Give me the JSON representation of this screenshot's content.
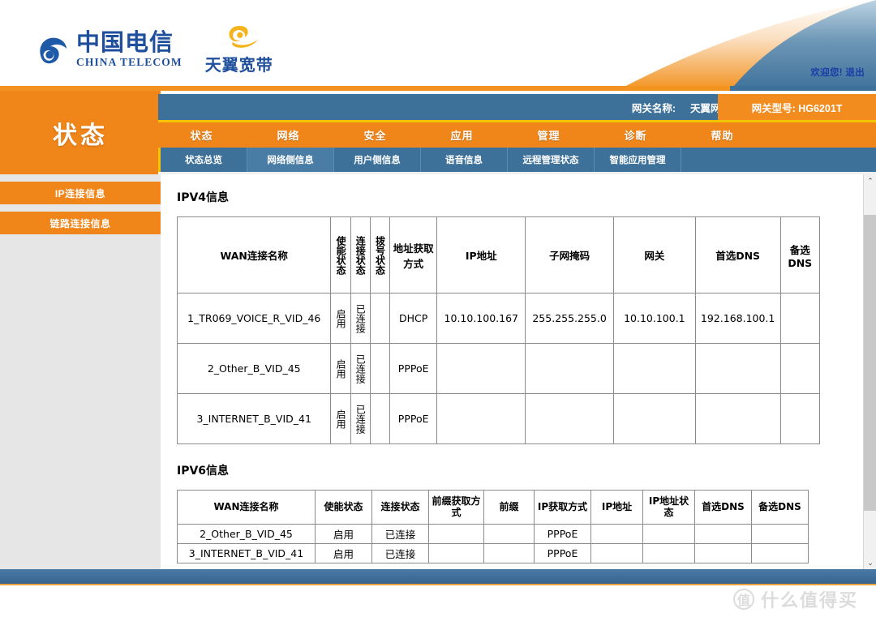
{
  "header": {
    "brand_cn": "中国电信",
    "brand_en": "CHINA TELECOM",
    "sub_brand": "天翼宽带",
    "welcome": "欢迎您!",
    "logout": "退出"
  },
  "gateway": {
    "name_label": "网关名称:",
    "name_value": "天翼网关-GPON",
    "model_label": "网关型号:",
    "model_value": "HG6201T",
    "model_text": "网关型号: HG6201T"
  },
  "sidebar": {
    "title": "状态",
    "items": [
      {
        "label": "IP连接信息"
      },
      {
        "label": "链路连接信息"
      }
    ]
  },
  "nav": {
    "items": [
      {
        "label": "状态"
      },
      {
        "label": "网络"
      },
      {
        "label": "安全"
      },
      {
        "label": "应用"
      },
      {
        "label": "管理"
      },
      {
        "label": "诊断"
      },
      {
        "label": "帮助"
      }
    ]
  },
  "subnav": {
    "items": [
      {
        "label": "状态总览",
        "active": false
      },
      {
        "label": "网络侧信息",
        "active": true
      },
      {
        "label": "用户侧信息",
        "active": false
      },
      {
        "label": "语音信息",
        "active": false
      },
      {
        "label": "远程管理状态",
        "active": false
      },
      {
        "label": "智能应用管理",
        "active": false
      }
    ]
  },
  "ipv4": {
    "title": "IPV4信息",
    "headers": [
      "WAN连接名称",
      "使能状态",
      "连接状态",
      "拨号状态",
      "地址获取方式",
      "IP地址",
      "子网掩码",
      "网关",
      "首选DNS",
      "备选DNS"
    ],
    "rows": [
      {
        "name": "1_TR069_VOICE_R_VID_46",
        "enable": "启用",
        "conn": "已连接",
        "dial": "",
        "mode": "DHCP",
        "ip": "10.10.100.167",
        "mask": "255.255.255.0",
        "gateway": "10.10.100.1",
        "dns1": "192.168.100.1",
        "dns2": ""
      },
      {
        "name": "2_Other_B_VID_45",
        "enable": "启用",
        "conn": "已连接",
        "dial": "",
        "mode": "PPPoE",
        "ip": "",
        "mask": "",
        "gateway": "",
        "dns1": "",
        "dns2": ""
      },
      {
        "name": "3_INTERNET_B_VID_41",
        "enable": "启用",
        "conn": "已连接",
        "dial": "",
        "mode": "PPPoE",
        "ip": "",
        "mask": "",
        "gateway": "",
        "dns1": "",
        "dns2": ""
      }
    ]
  },
  "ipv6": {
    "title": "IPV6信息",
    "headers": [
      "WAN连接名称",
      "使能状态",
      "连接状态",
      "前缀获取方式",
      "前缀",
      "IP获取方式",
      "IP地址",
      "IP地址状态",
      "首选DNS",
      "备选DNS"
    ],
    "rows": [
      {
        "name": "2_Other_B_VID_45",
        "enable": "启用",
        "conn": "已连接",
        "prefix_mode": "",
        "prefix": "",
        "ip_mode": "PPPoE",
        "ip": "",
        "ip_state": "",
        "dns1": "",
        "dns2": ""
      },
      {
        "name": "3_INTERNET_B_VID_41",
        "enable": "启用",
        "conn": "已连接",
        "prefix_mode": "",
        "prefix": "",
        "ip_mode": "PPPoE",
        "ip": "",
        "ip_state": "",
        "dns1": "",
        "dns2": ""
      }
    ]
  },
  "scrollbar": {
    "up": "⌃",
    "down": "⌄"
  },
  "watermark": {
    "mark": "值",
    "text": "什么值得买"
  },
  "colors": {
    "orange": "#f08519",
    "blue": "#3e719a",
    "yellow": "#f5c400",
    "link_blue": "#1a3ea8"
  }
}
